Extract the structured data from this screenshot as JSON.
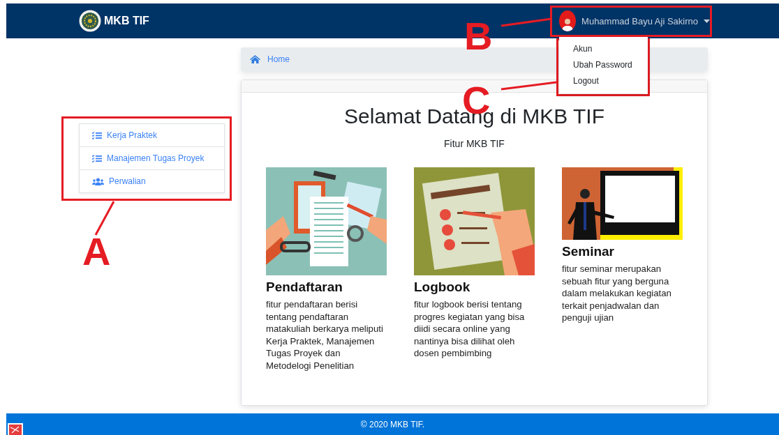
{
  "navbar": {
    "brand": "MKB TIF",
    "user": {
      "name": "Muhammad Bayu Aji Sakirno",
      "menu_open": true
    }
  },
  "user_menu": [
    {
      "label": "Akun"
    },
    {
      "label": "Ubah Password"
    },
    {
      "label": "Logout"
    }
  ],
  "sidebar": {
    "items": [
      {
        "label": "Kerja Praktek",
        "kind": "tasks"
      },
      {
        "label": "Manajemen Tugas Proyek",
        "kind": "tasks"
      },
      {
        "label": "Perwalian",
        "kind": "users"
      }
    ]
  },
  "breadcrumb": {
    "label": "Home"
  },
  "welcome": {
    "title": "Selamat Datang di MKB TIF",
    "subtitle": "Fitur MKB TIF"
  },
  "features": [
    {
      "kind": "documents",
      "title": "Pendaftaran",
      "description": "fitur pendaftaran berisi tentang pendaftaran matakuliah berkarya meliputi Kerja Praktek, Manajemen Tugas Proyek dan Metodelogi Penelitian"
    },
    {
      "kind": "checklist",
      "title": "Logbook",
      "description": "fitur logbook berisi tentang progres kegiatan yang bisa diidi secara online yang nantinya bisa dilihat oleh dosen pembimbing"
    },
    {
      "kind": "presentation",
      "title": "Seminar",
      "description": "fitur seminar merupakan sebuah fitur yang berguna dalam melakukan kegiatan terkait penjadwalan dan penguji ujian"
    }
  ],
  "footer": {
    "text": "© 2020 MKB TIF."
  },
  "annotations": [
    {
      "letter": "A"
    },
    {
      "letter": "B"
    },
    {
      "letter": "C"
    }
  ]
}
